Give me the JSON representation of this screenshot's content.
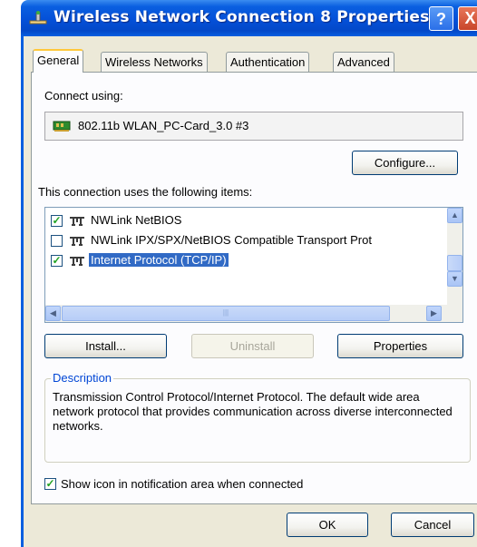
{
  "window": {
    "title": "Wireless Network Connection 8 Properties",
    "help_label": "?",
    "close_label": "X"
  },
  "tabs": [
    {
      "label": "General",
      "active": true
    },
    {
      "label": "Wireless Networks",
      "active": false
    },
    {
      "label": "Authentication",
      "active": false
    },
    {
      "label": "Advanced",
      "active": false
    }
  ],
  "general": {
    "connect_using_label": "Connect using:",
    "adapter_name": "802.11b WLAN_PC-Card_3.0 #3",
    "configure_label": "Configure...",
    "items_label": "This connection uses the following items:",
    "items": [
      {
        "label": "NWLink NetBIOS",
        "checked": true,
        "selected": false
      },
      {
        "label": "NWLink IPX/SPX/NetBIOS Compatible Transport Prot",
        "checked": false,
        "selected": false
      },
      {
        "label": "Internet Protocol (TCP/IP)",
        "checked": true,
        "selected": true
      }
    ],
    "install_label": "Install...",
    "uninstall_label": "Uninstall",
    "properties_label": "Properties",
    "description_legend": "Description",
    "description_text": "Transmission Control Protocol/Internet Protocol. The default wide area network protocol that provides communication across diverse interconnected networks.",
    "show_icon_label": "Show icon in notification area when connected",
    "show_icon_checked": true
  },
  "footer": {
    "ok_label": "OK",
    "cancel_label": "Cancel"
  },
  "icons": {
    "title": "network-connection-icon",
    "adapter": "network-card-icon",
    "item": "network-protocol-icon"
  },
  "colors": {
    "titlebar": "#0a5fe0",
    "selection": "#316ac5",
    "legend": "#0046d5",
    "active_tab_accent": "#ffc83c"
  }
}
